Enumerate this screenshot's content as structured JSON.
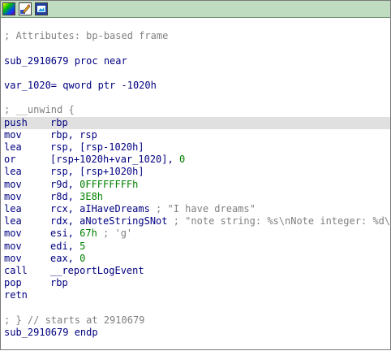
{
  "toolbar": {
    "icons": [
      "graph-color-icon",
      "edit-pencil-icon",
      "image-view-icon"
    ]
  },
  "colors": {
    "toolbar_bg": "#c0dcc0",
    "code_text": "#000080",
    "comment": "#808080",
    "number": "#008000",
    "highlight": "#e0e0e0"
  },
  "header": {
    "attributes_comment": "; Attributes: bp-based frame",
    "proc_decl": "sub_2910679 proc near",
    "var_decl": "var_1020= qword ptr -1020h",
    "unwind_open": "; __unwind {"
  },
  "lines": [
    {
      "mnem": "push",
      "op": "rbp",
      "highlight": true
    },
    {
      "mnem": "mov",
      "op": "rbp, rsp"
    },
    {
      "mnem": "lea",
      "op": "rsp, [rsp-1020h]"
    },
    {
      "mnem": "or",
      "op_a": "[rsp+1020h+var_1020], ",
      "op_num": "0"
    },
    {
      "mnem": "lea",
      "op": "rsp, [rsp+1020h]"
    },
    {
      "mnem": "mov",
      "op_a": "r9d, ",
      "op_num": "0FFFFFFFFh"
    },
    {
      "mnem": "mov",
      "op_a": "r8d, ",
      "op_num": "3E8h"
    },
    {
      "mnem": "lea",
      "op": "rcx, aIHaveDreams",
      "comment": " ; \"I have dreams\""
    },
    {
      "mnem": "lea",
      "op": "rdx, aNoteStringSNot",
      "comment": " ; \"note string: %s\\nNote integer: %d\\n\""
    },
    {
      "mnem": "mov",
      "op_a": "esi, ",
      "op_num": "67h",
      "comment": " ; 'g'"
    },
    {
      "mnem": "mov",
      "op_a": "edi, ",
      "op_num": "5"
    },
    {
      "mnem": "mov",
      "op_a": "eax, ",
      "op_num": "0"
    },
    {
      "mnem": "call",
      "op": "__reportLogEvent"
    },
    {
      "mnem": "pop",
      "op": "rbp"
    },
    {
      "mnem": "retn",
      "op": ""
    }
  ],
  "footer": {
    "unwind_close": "; } // starts at 2910679",
    "proc_end": "sub_2910679 endp"
  }
}
